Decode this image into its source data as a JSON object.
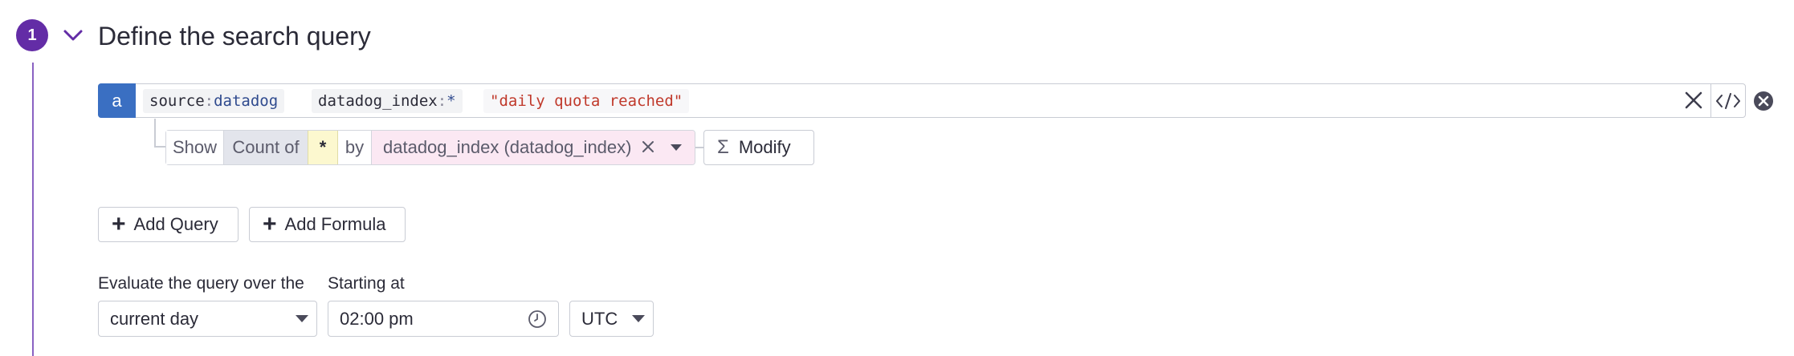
{
  "step": {
    "number": "1",
    "title": "Define the search query"
  },
  "query": {
    "letter": "a",
    "terms": [
      {
        "key": "source",
        "sep": ":",
        "value": "datadog"
      },
      {
        "key": "datadog_index",
        "sep": ":",
        "value": "*"
      }
    ],
    "text_term": "\"daily quota reached\""
  },
  "aggregation": {
    "show_label": "Show",
    "function": "Count of",
    "measure": "*",
    "by_label": "by",
    "group_by": "datadog_index (datadog_index)",
    "modify_label": "Modify"
  },
  "buttons": {
    "add_query": "Add Query",
    "add_formula": "Add Formula"
  },
  "evaluation": {
    "window_label": "Evaluate the query over the",
    "window_value": "current day",
    "start_label": "Starting at",
    "start_value": "02:00 pm",
    "timezone": "UTC"
  },
  "colors": {
    "step_purple": "#632ca6",
    "query_blue": "#3a6fc2",
    "group_pink": "#fbe8f3",
    "measure_yellow": "#fcf8cf"
  }
}
